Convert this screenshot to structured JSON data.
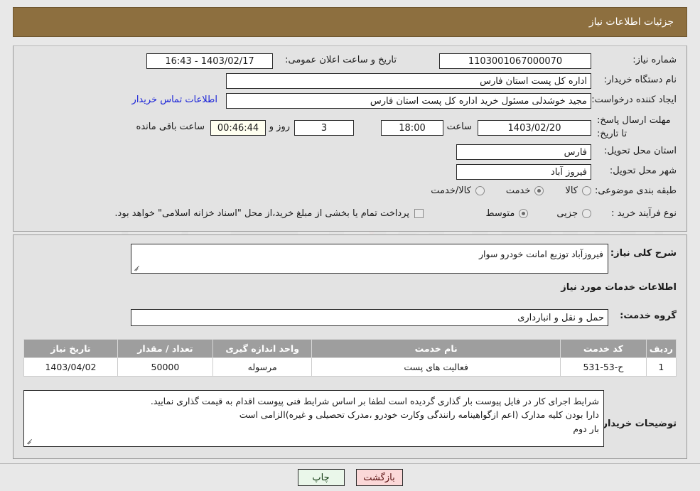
{
  "header": {
    "title": "جزئیات اطلاعات نیاز"
  },
  "form": {
    "need_number_label": "شماره نیاز:",
    "need_number_value": "1103001067000070",
    "announce_datetime_label": "تاریخ و ساعت اعلان عمومی:",
    "announce_datetime_value": "1403/02/17 - 16:43",
    "buyer_org_label": "نام دستگاه خریدار:",
    "buyer_org_value": "اداره کل پست استان فارس",
    "requester_label": "ایجاد کننده درخواست:",
    "requester_value": "مجید خوشدلی مسئول خرید اداره کل پست استان فارس",
    "contact_link": "اطلاعات تماس خریدار",
    "deadline_label": "مهلت ارسال پاسخ: تا تاریخ:",
    "deadline_date": "1403/02/20",
    "hour_label": "ساعت",
    "deadline_time": "18:00",
    "days_remaining": "3",
    "days_and_label": "روز و",
    "countdown": "00:46:44",
    "remaining_label": "ساعت باقی مانده",
    "delivery_province_label": "استان محل تحویل:",
    "delivery_province_value": "فارس",
    "delivery_city_label": "شهر محل تحویل:",
    "delivery_city_value": "فیروز آباد",
    "category_label": "طبقه بندی موضوعی:",
    "category_options": [
      {
        "label": "کالا",
        "selected": false
      },
      {
        "label": "خدمت",
        "selected": true
      },
      {
        "label": "کالا/خدمت",
        "selected": false
      }
    ],
    "process_type_label": "نوع فرآیند خرید :",
    "process_options": [
      {
        "label": "جزیی",
        "selected": false
      },
      {
        "label": "متوسط",
        "selected": true
      }
    ],
    "treasury_checkbox_label": "پرداخت تمام یا بخشی از مبلغ خرید،از محل \"اسناد خزانه اسلامی\" خواهد بود.",
    "treasury_checked": false
  },
  "details": {
    "general_description_label": "شرح کلی نیاز:",
    "general_description_value": "فیروزآباد توزیع امانت خودرو سوار",
    "services_section_title": "اطلاعات خدمات مورد نیاز",
    "service_group_label": "گروه خدمت:",
    "service_group_value": "حمل و نقل و انبارداری"
  },
  "table": {
    "columns": [
      "ردیف",
      "کد خدمت",
      "نام خدمت",
      "واحد اندازه گیری",
      "تعداد / مقدار",
      "تاریخ نیاز"
    ],
    "rows": [
      {
        "row_no": "1",
        "service_code": "ح-53-531",
        "service_name": "فعالیت های پست",
        "unit": "مرسوله",
        "quantity": "50000",
        "need_date": "1403/04/02"
      }
    ]
  },
  "buyer_notes": {
    "label": "توضیحات خریدار:",
    "lines": [
      "شرایط اجرای کار در فایل پیوست بار گذاری گردیده است لطفا بر اساس شرایط فنی پیوست اقدام به قیمت گذاری نمایید.",
      "دارا بودن کلیه مدارک (اعم ازگواهینامه رانندگی وکارت خودرو ،مدرک تحصیلی و غیره)الزامی است",
      "بار دوم"
    ]
  },
  "footer": {
    "print_button": "چاپ",
    "back_button": "بازگشت"
  },
  "watermark": {
    "text": "AriaTender.net"
  },
  "colors": {
    "header_bar": "#8d6f3f",
    "panel_bg": "#e3e3e3",
    "page_bg": "#e8e8e8",
    "table_header": "#9e9e9e",
    "link": "#1a23d8",
    "print_button": "#eaf7ea",
    "back_button": "#fbd8d8",
    "countdown_bg": "#fffff0"
  }
}
